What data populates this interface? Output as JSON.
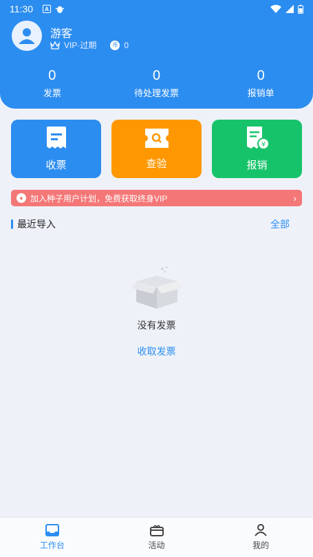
{
  "status_bar": {
    "time": "11:30"
  },
  "profile": {
    "name": "游客",
    "vip_status": "VIP·过期",
    "coins": "0"
  },
  "stats": [
    {
      "value": "0",
      "label": "发票"
    },
    {
      "value": "0",
      "label": "待处理发票"
    },
    {
      "value": "0",
      "label": "报销单"
    }
  ],
  "actions": [
    {
      "label": "收票",
      "icon": "receipt-icon",
      "color": "#2c8df0"
    },
    {
      "label": "查验",
      "icon": "ticket-search-icon",
      "color": "#ff9700"
    },
    {
      "label": "报销",
      "icon": "reimbursement-icon",
      "color": "#17c36a"
    }
  ],
  "promo": {
    "text": "加入种子用户计划，免费获取终身VIP"
  },
  "recent": {
    "title": "最近导入",
    "all_label": "全部"
  },
  "empty_state": {
    "text": "没有发票",
    "action_label": "收取发票"
  },
  "tabs": [
    {
      "label": "工作台",
      "icon": "inbox-icon",
      "active": true
    },
    {
      "label": "活动",
      "icon": "gift-box-icon",
      "active": false
    },
    {
      "label": "我的",
      "icon": "user-icon",
      "active": false
    }
  ]
}
